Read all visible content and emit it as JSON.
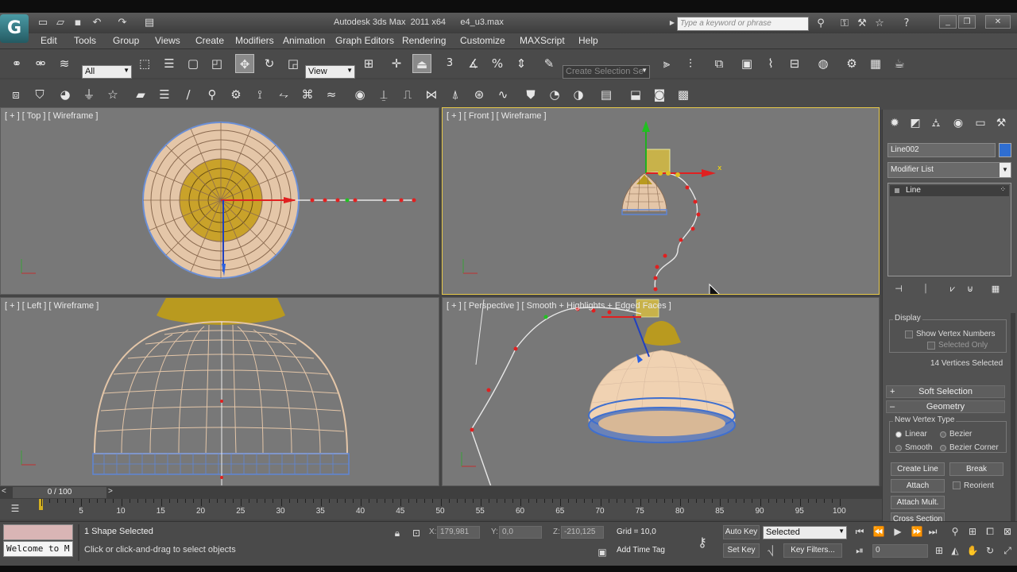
{
  "title_bar": {
    "logo": "G",
    "title": "Autodesk 3ds Max  2011 x64      e4_u3.max",
    "search_placeholder": "Type a keyword or phrase",
    "minimize": "_",
    "restore": "❐",
    "close": "✕"
  },
  "menu": [
    "Edit",
    "Tools",
    "Group",
    "Views",
    "Create",
    "Modifiers",
    "Animation",
    "Graph Editors",
    "Rendering",
    "Customize",
    "MAXScript",
    "Help"
  ],
  "toolbar": {
    "selection_filter": "All",
    "reference_coord": "View",
    "named_selection_set": "Create Selection Se",
    "snaps_label": "3"
  },
  "viewports": {
    "top": "[ + ] [ Top ] [ Wireframe ]",
    "front": "[ + ] [ Front ] [ Wireframe ]",
    "left": "[ + ] [ Left ] [ Wireframe ]",
    "perspective": "[ + ] [ Perspective ] [ Smooth + Highlights + Edged Faces ]"
  },
  "command_panel": {
    "object_name": "Line002",
    "object_color": "#2f6ed1",
    "modifier_list": "Modifier List",
    "stack": [
      "Line"
    ],
    "display": {
      "title": "Display",
      "show_vertex_numbers": "Show Vertex Numbers",
      "selected_only": "Selected Only",
      "status": "14 Vertices Selected"
    },
    "rollouts": {
      "soft_selection": "Soft Selection",
      "geometry": "Geometry"
    },
    "new_vertex_type": {
      "title": "New Vertex Type",
      "options": [
        "Linear",
        "Bezier",
        "Smooth",
        "Bezier Corner"
      ],
      "selected": "Linear"
    },
    "buttons": {
      "create_line": "Create Line",
      "break": "Break",
      "attach": "Attach",
      "reorient": "Reorient",
      "attach_mult": "Attach Mult.",
      "cross_section": "Cross Section"
    }
  },
  "timeline": {
    "slider": "0 / 100",
    "ticks": [
      "5",
      "10",
      "15",
      "20",
      "25",
      "30",
      "35",
      "40",
      "45",
      "50",
      "55",
      "60",
      "65",
      "70",
      "75",
      "80",
      "85",
      "90",
      "95",
      "100"
    ]
  },
  "status": {
    "maxscript": "Welcome to M",
    "selection": "1 Shape Selected",
    "prompt": "Click or click-and-drag to select objects",
    "x_label": "X:",
    "x": "179,981",
    "y_label": "Y:",
    "y": "0,0",
    "z_label": "Z:",
    "z": "-210,125",
    "grid": "Grid = 10,0",
    "add_time_tag": "Add Time Tag",
    "auto_key": "Auto Key",
    "set_key": "Set Key",
    "key_mode": "Selected",
    "key_filters": "Key Filters...",
    "frame": "0"
  },
  "colors": {
    "viewport_bg": "#787878",
    "active_border": "#e6c84a",
    "wire_shade": "#e4c6a8",
    "lamp_gold": "#b99a1f",
    "selection_blue": "#3f6fcf",
    "vertex_red": "#e02020"
  }
}
